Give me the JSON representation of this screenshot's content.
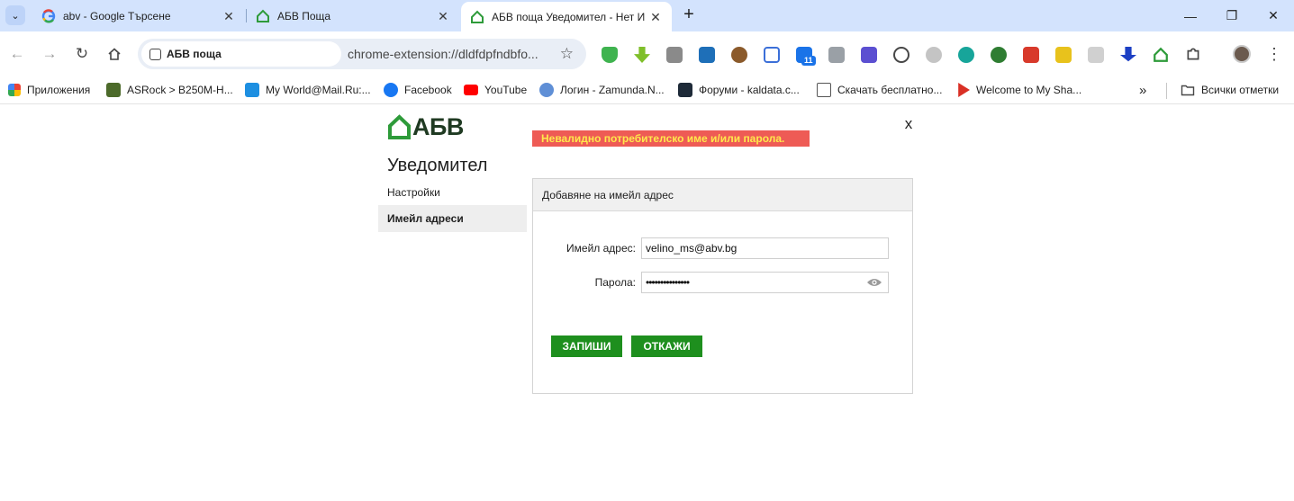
{
  "browser": {
    "tabs": [
      {
        "title": "abv - Google Търсене",
        "favicon": "google-icon",
        "active": false
      },
      {
        "title": "АБВ Поща",
        "favicon": "abv-house-icon",
        "active": false
      },
      {
        "title": "АБВ поща Уведомител - Нет И",
        "favicon": "abv-house-icon",
        "active": true
      }
    ],
    "new_tab": "+",
    "window_controls": {
      "minimize": "—",
      "maximize": "❐",
      "close": "✕"
    }
  },
  "toolbar": {
    "site_chip": "АБВ поща",
    "url": "chrome-extension://dldfdpfndbfo...",
    "extension_badge": "11"
  },
  "bookmarks": [
    {
      "label": "Приложения",
      "icon": "apps-grid-icon"
    },
    {
      "label": "ASRock > B250M-H...",
      "icon": "asrock-icon"
    },
    {
      "label": "My World@Mail.Ru:...",
      "icon": "mailru-icon"
    },
    {
      "label": "Facebook",
      "icon": "facebook-icon"
    },
    {
      "label": "YouTube",
      "icon": "youtube-icon"
    },
    {
      "label": "Логин - Zamunda.N...",
      "icon": "zamunda-icon"
    },
    {
      "label": "Форуми - kaldata.c...",
      "icon": "kaldata-icon"
    },
    {
      "label": "Скачать бесплатно...",
      "icon": "download-page-icon"
    },
    {
      "label": "Welcome to My Sha...",
      "icon": "share-icon"
    }
  ],
  "bookmarks_overflow": "»",
  "all_bookmarks": "Всички отметки",
  "page": {
    "logo_text": "АБВ",
    "close": "x",
    "error": "Невалидно потребителско име и/или парола.",
    "app_title": "Уведомител",
    "sidebar": [
      {
        "label": "Настройки",
        "active": false
      },
      {
        "label": "Имейл адреси",
        "active": true
      }
    ],
    "panel_title": "Добавяне на имейл адрес",
    "form": {
      "email_label": "Имейл адрес:",
      "email_value": "velino_ms@abv.bg",
      "password_label": "Парола:",
      "password_value": "•••••••••••••••"
    },
    "save_button": "ЗАПИШИ",
    "cancel_button": "ОТКАЖИ"
  },
  "colors": {
    "tabstrip": "#d3e3fd",
    "brand_green": "#1e8f1e",
    "error_bg": "#ee5b55",
    "error_text": "#ffe94b"
  }
}
